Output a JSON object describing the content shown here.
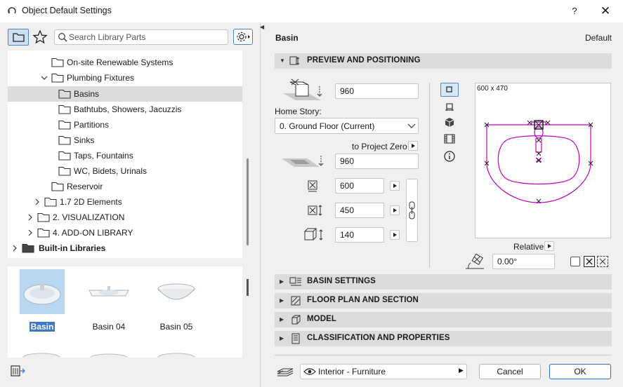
{
  "window": {
    "title": "Object Default Settings",
    "help_label": "?",
    "close_label": "✕"
  },
  "library": {
    "search_placeholder": "Search Library Parts",
    "tree": [
      {
        "label": "On-site Renewable Systems",
        "expanded": false,
        "has_chevron": false,
        "selected": false,
        "bold": false
      },
      {
        "label": "Plumbing Fixtures",
        "expanded": true,
        "has_chevron": true,
        "selected": false,
        "bold": false
      },
      {
        "label": "Basins",
        "expanded": false,
        "has_chevron": false,
        "selected": true,
        "bold": false
      },
      {
        "label": "Bathtubs, Showers, Jacuzzis",
        "expanded": false,
        "has_chevron": false,
        "selected": false,
        "bold": false
      },
      {
        "label": "Partitions",
        "expanded": false,
        "has_chevron": false,
        "selected": false,
        "bold": false
      },
      {
        "label": "Sinks",
        "expanded": false,
        "has_chevron": false,
        "selected": false,
        "bold": false
      },
      {
        "label": "Taps, Fountains",
        "expanded": false,
        "has_chevron": false,
        "selected": false,
        "bold": false
      },
      {
        "label": "WC, Bidets, Urinals",
        "expanded": false,
        "has_chevron": false,
        "selected": false,
        "bold": false
      },
      {
        "label": "Reservoir",
        "expanded": false,
        "has_chevron": false,
        "selected": false,
        "bold": false
      },
      {
        "label": "1.7 2D Elements",
        "expanded": false,
        "has_chevron": true,
        "selected": false,
        "bold": false
      },
      {
        "label": "2. VISUALIZATION",
        "expanded": false,
        "has_chevron": true,
        "selected": false,
        "bold": false
      },
      {
        "label": "4. ADD-ON LIBRARY",
        "expanded": false,
        "has_chevron": true,
        "selected": false,
        "bold": false
      },
      {
        "label": "Built-in Libraries",
        "expanded": false,
        "has_chevron": true,
        "selected": false,
        "bold": true
      }
    ],
    "thumbnails": [
      {
        "label": "Basin",
        "selected": true
      },
      {
        "label": "Basin 04",
        "selected": false
      },
      {
        "label": "Basin 05",
        "selected": false
      }
    ]
  },
  "part": {
    "name": "Basin",
    "state_label": "Default"
  },
  "preview_positioning": {
    "header": "PREVIEW AND POSITIONING",
    "height_value": "960",
    "home_story_label": "Home Story:",
    "home_story_value": "0. Ground Floor (Current)",
    "to_project_zero_label": "to Project Zero",
    "elevation_value": "960",
    "width_value": "600",
    "depth_value": "450",
    "object_height_value": "140",
    "preview_size_label": "600 x 470",
    "relative_label": "Relative",
    "angle_value": "0.00°"
  },
  "sections": [
    {
      "label": "BASIN SETTINGS"
    },
    {
      "label": "FLOOR PLAN AND SECTION"
    },
    {
      "label": "MODEL"
    },
    {
      "label": "CLASSIFICATION AND PROPERTIES"
    }
  ],
  "footer": {
    "layer_value": "Interior - Furniture",
    "cancel_label": "Cancel",
    "ok_label": "OK"
  },
  "colors": {
    "accent": "#3c78c8",
    "selection_gray": "#dcdcdc",
    "plan_magenta": "#c000c0"
  }
}
